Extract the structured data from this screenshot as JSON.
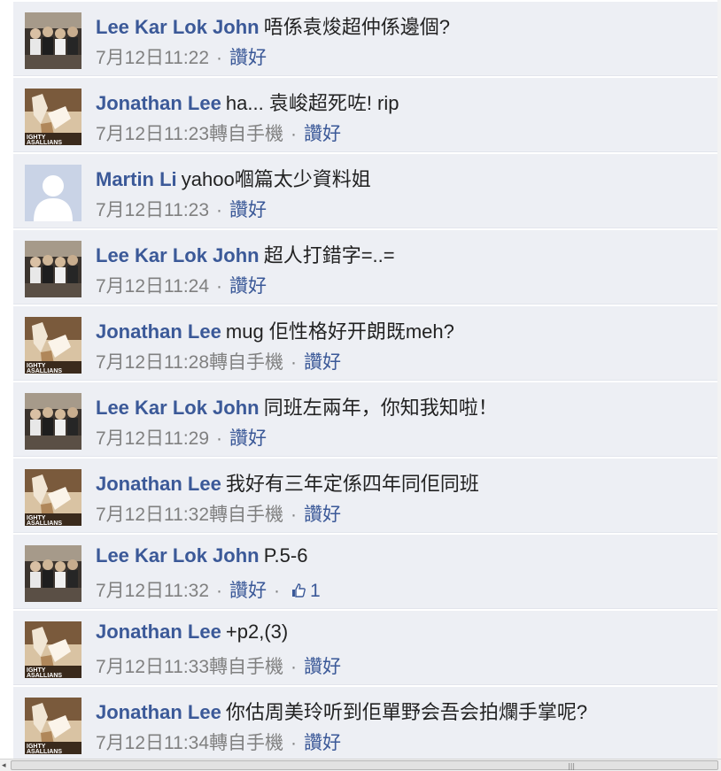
{
  "comments": [
    {
      "author": "Lee Kar Lok John",
      "text": "唔係袁焌超仲係邊個?",
      "time": "7月12日11:22",
      "via": "",
      "like": "讚好",
      "likes": "",
      "avatar": "group-photo"
    },
    {
      "author": "Jonathan Lee",
      "text": "ha... 袁峻超死咗! rip",
      "time": "7月12日11:23",
      "via": "轉自手機",
      "like": "讚好",
      "likes": "",
      "avatar": "sports-photo"
    },
    {
      "author": "Martin Li",
      "text": "yahoo嗰篇太少資料姐",
      "time": "7月12日11:23",
      "via": "",
      "like": "讚好",
      "likes": "",
      "avatar": "default-silhouette"
    },
    {
      "author": "Lee Kar Lok John",
      "text": "超人打錯字=..=",
      "time": "7月12日11:24",
      "via": "",
      "like": "讚好",
      "likes": "",
      "avatar": "group-photo"
    },
    {
      "author": "Jonathan Lee",
      "text": "mug 佢性格好开朗既meh?",
      "time": "7月12日11:28",
      "via": "轉自手機",
      "like": "讚好",
      "likes": "",
      "avatar": "sports-photo"
    },
    {
      "author": "Lee Kar Lok John",
      "text": "同班左兩年，你知我知啦！",
      "time": "7月12日11:29",
      "via": "",
      "like": "讚好",
      "likes": "",
      "avatar": "group-photo"
    },
    {
      "author": "Jonathan Lee",
      "text": "我好有三年定係四年同佢同班",
      "time": "7月12日11:32",
      "via": "轉自手機",
      "like": "讚好",
      "likes": "",
      "avatar": "sports-photo"
    },
    {
      "author": "Lee Kar Lok John",
      "text": "P.5-6",
      "time": "7月12日11:32",
      "via": "",
      "like": "讚好",
      "likes": "1",
      "avatar": "group-photo"
    },
    {
      "author": "Jonathan Lee",
      "text": "+p2,(3)",
      "time": "7月12日11:33",
      "via": "轉自手機",
      "like": "讚好",
      "likes": "",
      "avatar": "sports-photo"
    },
    {
      "author": "Jonathan Lee",
      "text": "你估周美玲听到佢單野会吾会拍爛手掌呢?",
      "time": "7月12日11:34",
      "via": "轉自手機",
      "like": "讚好",
      "likes": "",
      "avatar": "sports-photo"
    }
  ],
  "separator": "·",
  "colors": {
    "name": "#3b5998",
    "background": "#edeff4",
    "meta": "#808080"
  },
  "icons": {
    "like_count": "thumbs-up-icon",
    "scroll_left": "scroll-left-arrow-icon"
  }
}
